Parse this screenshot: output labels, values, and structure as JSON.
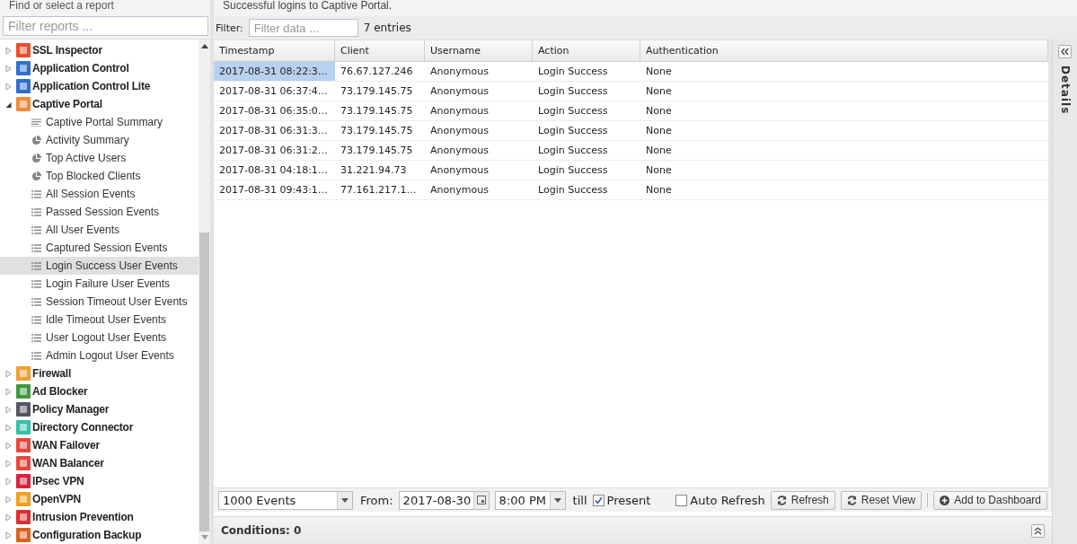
{
  "sidebar": {
    "title": "Find or select a report",
    "filter": {
      "placeholder": "Filter reports ..."
    },
    "tree": [
      {
        "label": "SSL Inspector",
        "color": "#e8502c",
        "expanded": false
      },
      {
        "label": "Application Control",
        "color": "#2f6fd0",
        "expanded": false
      },
      {
        "label": "Application Control Lite",
        "color": "#2f6fd0",
        "expanded": false
      },
      {
        "label": "Captive Portal",
        "color": "#f08a3c",
        "expanded": true,
        "children": [
          {
            "label": "Captive Portal Summary",
            "kind": "text",
            "selected": false
          },
          {
            "label": "Activity Summary",
            "kind": "pie",
            "selected": false
          },
          {
            "label": "Top Active Users",
            "kind": "pie",
            "selected": false
          },
          {
            "label": "Top Blocked Clients",
            "kind": "pie",
            "selected": false
          },
          {
            "label": "All Session Events",
            "kind": "list",
            "selected": false
          },
          {
            "label": "Passed Session Events",
            "kind": "list",
            "selected": false
          },
          {
            "label": "All User Events",
            "kind": "list",
            "selected": false
          },
          {
            "label": "Captured Session Events",
            "kind": "list",
            "selected": false
          },
          {
            "label": "Login Success User Events",
            "kind": "list",
            "selected": true
          },
          {
            "label": "Login Failure User Events",
            "kind": "list",
            "selected": false
          },
          {
            "label": "Session Timeout User Events",
            "kind": "list",
            "selected": false
          },
          {
            "label": "Idle Timeout User Events",
            "kind": "list",
            "selected": false
          },
          {
            "label": "User Logout User Events",
            "kind": "list",
            "selected": false
          },
          {
            "label": "Admin Logout User Events",
            "kind": "list",
            "selected": false
          }
        ]
      },
      {
        "label": "Firewall",
        "color": "#f0a030",
        "expanded": false
      },
      {
        "label": "Ad Blocker",
        "color": "#3f9a3f",
        "expanded": false
      },
      {
        "label": "Policy Manager",
        "color": "#555566",
        "expanded": false
      },
      {
        "label": "Directory Connector",
        "color": "#35c0a8",
        "expanded": false
      },
      {
        "label": "WAN Failover",
        "color": "#e8463c",
        "expanded": false
      },
      {
        "label": "WAN Balancer",
        "color": "#e8463c",
        "expanded": false
      },
      {
        "label": "IPsec VPN",
        "color": "#d8243c",
        "expanded": false
      },
      {
        "label": "OpenVPN",
        "color": "#f0a020",
        "expanded": false
      },
      {
        "label": "Intrusion Prevention",
        "color": "#d83030",
        "expanded": false
      },
      {
        "label": "Configuration Backup",
        "color": "#e06020",
        "expanded": false
      }
    ]
  },
  "report": {
    "description": "Successful logins to Captive Portal.",
    "filter_label": "Filter:",
    "filter": {
      "placeholder": "Filter data ..."
    },
    "count": "7 entries",
    "table": {
      "columns": [
        "Timestamp",
        "Client",
        "Username",
        "Action",
        "Authentication"
      ],
      "rows": [
        {
          "cells": [
            "2017-08-31 08:22:3…",
            "76.67.127.246",
            "Anonymous",
            "Login Success",
            "None"
          ],
          "selected": true
        },
        {
          "cells": [
            "2017-08-31 06:37:4…",
            "73.179.145.75",
            "Anonymous",
            "Login Success",
            "None"
          ],
          "selected": false
        },
        {
          "cells": [
            "2017-08-31 06:35:0…",
            "73.179.145.75",
            "Anonymous",
            "Login Success",
            "None"
          ],
          "selected": false
        },
        {
          "cells": [
            "2017-08-31 06:31:3…",
            "73.179.145.75",
            "Anonymous",
            "Login Success",
            "None"
          ],
          "selected": false
        },
        {
          "cells": [
            "2017-08-31 06:31:2…",
            "73.179.145.75",
            "Anonymous",
            "Login Success",
            "None"
          ],
          "selected": false
        },
        {
          "cells": [
            "2017-08-31 04:18:1…",
            "31.221.94.73",
            "Anonymous",
            "Login Success",
            "None"
          ],
          "selected": false
        },
        {
          "cells": [
            "2017-08-31 09:43:1…",
            "77.161.217.1…",
            "Anonymous",
            "Login Success",
            "None"
          ],
          "selected": false
        }
      ]
    },
    "toolbar": {
      "limit": "1000 Events",
      "from_label": "From:",
      "from_date": "2017-08-30",
      "from_time": "8:00 PM",
      "till_label": "till",
      "present": {
        "label": "Present",
        "checked": true
      },
      "auto_refresh": {
        "label": "Auto Refresh",
        "checked": false
      },
      "buttons": [
        "Refresh",
        "Reset View",
        "Add to Dashboard"
      ]
    },
    "conditions": "Conditions: 0"
  },
  "details": {
    "label": "Details"
  }
}
